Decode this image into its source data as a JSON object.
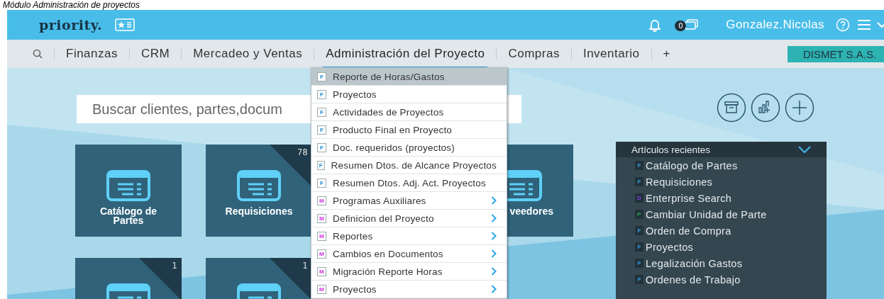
{
  "caption": "Módulo Administración de proyectos",
  "topbar": {
    "logo": "priority.",
    "user": "Gonzalez.Nicolas",
    "windows_count": "0"
  },
  "nav": {
    "items": [
      {
        "label": "Finanzas",
        "selected": false
      },
      {
        "label": "CRM",
        "selected": false
      },
      {
        "label": "Mercadeo y Ventas",
        "selected": false
      },
      {
        "label": "Administración del Proyecto",
        "selected": true
      },
      {
        "label": "Compras",
        "selected": false
      },
      {
        "label": "Inventario",
        "selected": false
      },
      {
        "label": "+",
        "selected": false
      }
    ],
    "company": "DISMET S.A.S."
  },
  "search": {
    "placeholder": "Buscar clientes, partes,docum"
  },
  "tiles": [
    {
      "label": "Catálogo de Partes",
      "kind": "full"
    },
    {
      "label": "Requisiciones",
      "count": "78",
      "kind": "full"
    },
    {
      "kind": "hidden"
    },
    {
      "label": "veedores",
      "kind": "covered"
    },
    {
      "count": "1",
      "kind": "cut"
    },
    {
      "count": "1",
      "kind": "cut"
    }
  ],
  "menu": {
    "items": [
      {
        "badge": "F",
        "kind": "form",
        "label": "Reporte de Horas/Gastos",
        "submenu": false,
        "selected": true
      },
      {
        "badge": "F",
        "kind": "form",
        "label": "Proyectos",
        "submenu": false,
        "selected": false
      },
      {
        "badge": "F",
        "kind": "form",
        "label": "Actividades de Proyectos",
        "submenu": false,
        "selected": false
      },
      {
        "badge": "F",
        "kind": "form",
        "label": "Producto Final en Proyecto",
        "submenu": false,
        "selected": false
      },
      {
        "badge": "F",
        "kind": "form",
        "label": "Doc. requeridos (proyectos)",
        "submenu": false,
        "selected": false
      },
      {
        "badge": "F",
        "kind": "form",
        "label": "Resumen Dtos. de Alcance Proyectos",
        "submenu": false,
        "selected": false
      },
      {
        "badge": "F",
        "kind": "form",
        "label": "Resumen Dtos. Adj. Act. Proyectos",
        "submenu": false,
        "selected": false
      },
      {
        "badge": "M",
        "kind": "menu",
        "label": "Programas Auxiliares",
        "submenu": true,
        "selected": false
      },
      {
        "badge": "M",
        "kind": "menu",
        "label": "Definicion del Proyecto",
        "submenu": true,
        "selected": false
      },
      {
        "badge": "M",
        "kind": "menu",
        "label": "Reportes",
        "submenu": true,
        "selected": false
      },
      {
        "badge": "M",
        "kind": "menu",
        "label": "Cambios en Documentos",
        "submenu": true,
        "selected": false
      },
      {
        "badge": "M",
        "kind": "menu",
        "label": "Migración Reporte Horas",
        "submenu": true,
        "selected": false
      },
      {
        "badge": "M",
        "kind": "menu",
        "label": "Proyectos",
        "submenu": true,
        "selected": false
      }
    ]
  },
  "recent": {
    "title": "Artículos recientes",
    "expanded": true,
    "items": [
      {
        "badge": "F",
        "kind": "form",
        "label": "Catálogo de Partes"
      },
      {
        "badge": "F",
        "kind": "form",
        "label": "Requisiciones"
      },
      {
        "badge": "D",
        "kind": "document",
        "label": "Enterprise Search"
      },
      {
        "badge": "P",
        "kind": "procedure",
        "label": "Cambiar Unidad de Parte"
      },
      {
        "badge": "F",
        "kind": "form",
        "label": "Orden de Compra"
      },
      {
        "badge": "F",
        "kind": "form",
        "label": "Proyectos"
      },
      {
        "badge": "F",
        "kind": "form",
        "label": "Legalización Gastos"
      },
      {
        "badge": "F",
        "kind": "form",
        "label": "Ordenes de Trabajo"
      }
    ]
  }
}
